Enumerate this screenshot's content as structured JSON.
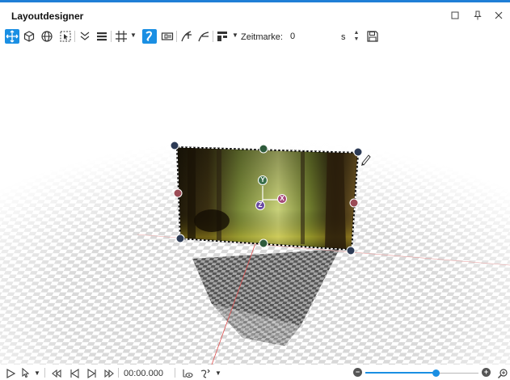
{
  "window": {
    "title": "Layoutdesigner",
    "controls": [
      "maximize-icon",
      "pin-icon",
      "close-icon"
    ]
  },
  "toolbar": {
    "tools": [
      {
        "name": "move-tool-icon",
        "active": true
      },
      {
        "name": "cube-3d-icon",
        "active": false
      },
      {
        "name": "globe-icon",
        "active": false
      },
      {
        "name": "selection-icon",
        "active": false
      },
      {
        "name": "collapse-icon",
        "active": false
      },
      {
        "name": "list-icon",
        "active": false
      },
      {
        "name": "grid-icon",
        "active": false
      },
      {
        "name": "curve-path-icon",
        "active": true
      },
      {
        "name": "camera-frame-icon",
        "active": false
      },
      {
        "name": "keyframe-add-icon",
        "active": false
      },
      {
        "name": "keyframe-path-icon",
        "active": false
      },
      {
        "name": "align-icon",
        "active": false
      }
    ],
    "zeitmarke_label": "Zeitmarke:",
    "zeitmarke_value": "0",
    "zeitmarke_unit": "s",
    "save_icon": "save-icon"
  },
  "stage": {
    "accent": "#1a8fe3",
    "handle_colors": {
      "corner": "#2d3b55",
      "rotate_y": "#2e5a3b",
      "rotate_x": "#9b4b55"
    },
    "gizmo_axes": [
      "Y",
      "X",
      "Z"
    ],
    "gizmo_colors": {
      "y": "#3a6e4a",
      "x": "#a64a7a",
      "z": "#6a4aa0"
    }
  },
  "bottombar": {
    "timecode": "00:00.000",
    "zoom_level": 0.62,
    "zoom_minus_label": "−",
    "zoom_plus_label": "+"
  }
}
